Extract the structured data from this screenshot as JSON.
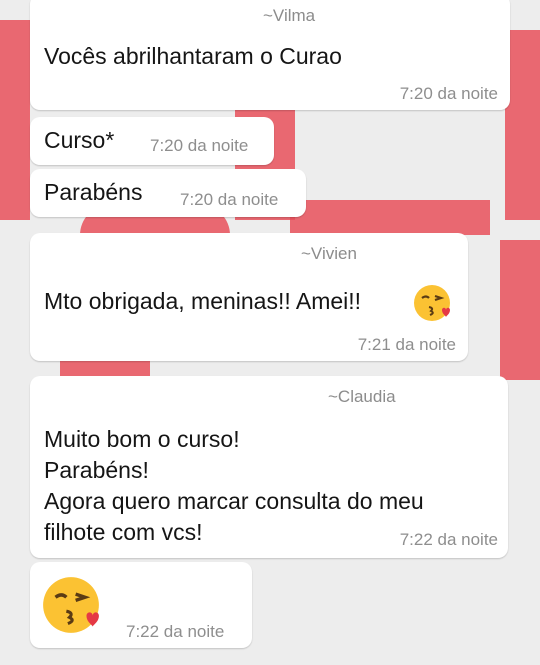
{
  "messages": [
    {
      "sender": "~Vilma",
      "text": "Vocês abrilhantaram o Curao",
      "time": "7:20 da noite"
    },
    {
      "text": "Curso*",
      "time": "7:20 da noite"
    },
    {
      "text": "Parabéns",
      "time": "7:20 da noite"
    },
    {
      "sender": "~Vivien",
      "text": "Mto obrigada, meninas!! Amei!!",
      "emoji": "kissing-face-emoji",
      "time": "7:21 da noite"
    },
    {
      "sender": "~Claudia",
      "lines": [
        "Muito bom o curso!",
        "Parabéns!",
        "Agora quero marcar consulta do meu",
        "filhote com vcs!"
      ],
      "time": "7:22 da noite"
    },
    {
      "emoji": "kissing-face-emoji",
      "time": "7:22 da noite"
    }
  ],
  "colors": {
    "wallpaper_accent": "#e8505b",
    "bubble": "#ffffff",
    "meta_text": "#8e8e8e"
  }
}
